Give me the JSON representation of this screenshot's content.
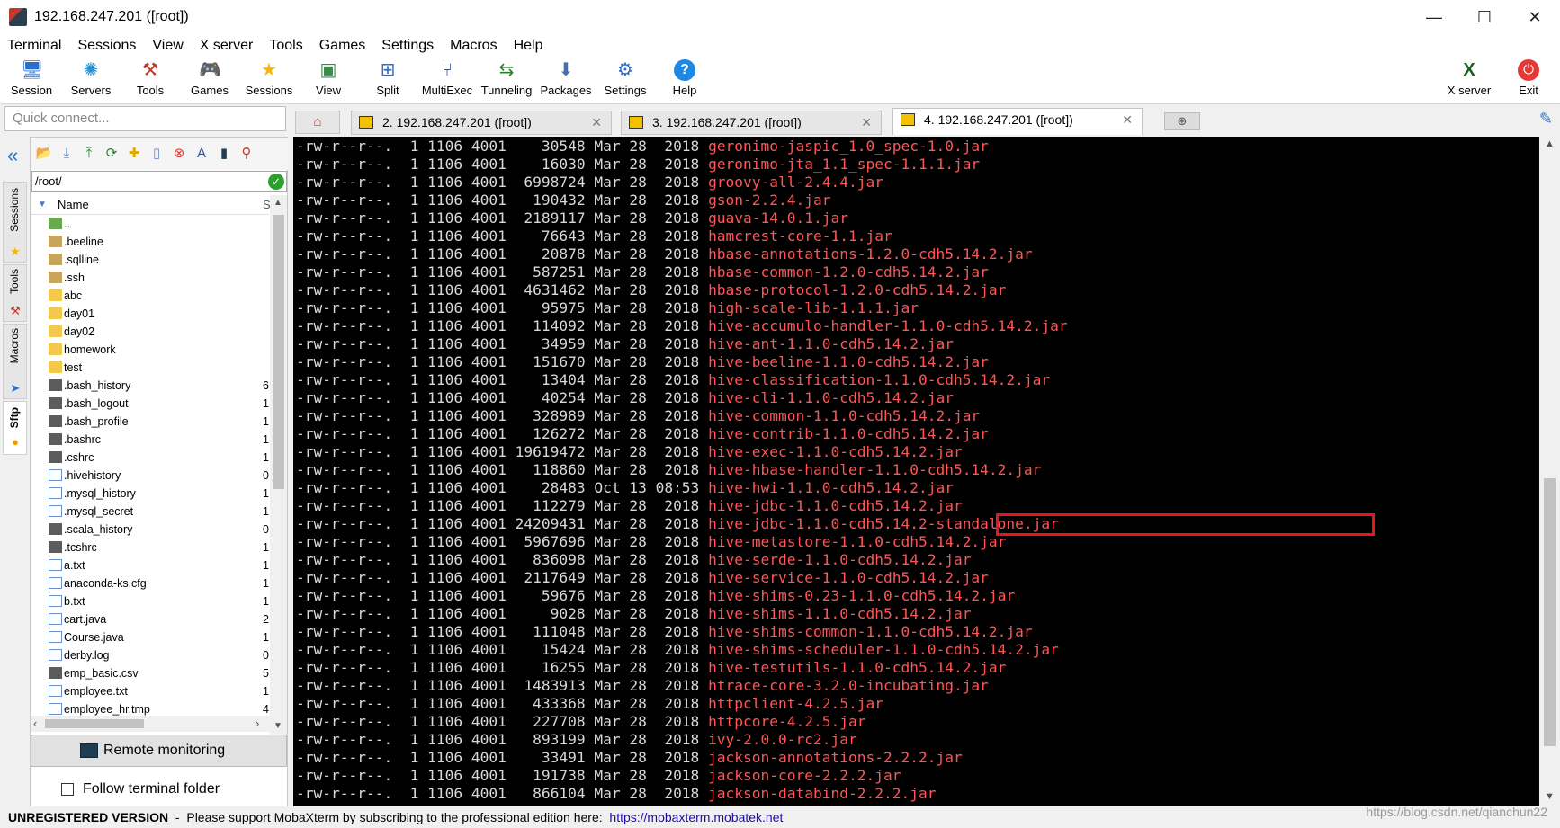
{
  "window": {
    "title": "192.168.247.201 ([root])",
    "minimize": "—",
    "maximize": "☐",
    "close": "✕"
  },
  "menu": [
    "Terminal",
    "Sessions",
    "View",
    "X server",
    "Tools",
    "Games",
    "Settings",
    "Macros",
    "Help"
  ],
  "toolbar": [
    {
      "label": "Session",
      "icon": "session-icon"
    },
    {
      "label": "Servers",
      "icon": "servers-icon"
    },
    {
      "label": "Tools",
      "icon": "tools-icon"
    },
    {
      "label": "Games",
      "icon": "games-icon"
    },
    {
      "label": "Sessions",
      "icon": "star-icon"
    },
    {
      "label": "View",
      "icon": "view-icon"
    },
    {
      "label": "Split",
      "icon": "split-icon"
    },
    {
      "label": "MultiExec",
      "icon": "multiexec-icon"
    },
    {
      "label": "Tunneling",
      "icon": "tunneling-icon"
    },
    {
      "label": "Packages",
      "icon": "packages-icon"
    },
    {
      "label": "Settings",
      "icon": "gear-icon"
    },
    {
      "label": "Help",
      "icon": "help-icon"
    }
  ],
  "toolbar_right": [
    {
      "label": "X server",
      "icon": "x-server-icon"
    },
    {
      "label": "Exit",
      "icon": "power-icon"
    }
  ],
  "quick_connect": {
    "placeholder": "Quick connect..."
  },
  "tabs": [
    {
      "label": "2. 192.168.247.201 ([root])",
      "active": false
    },
    {
      "label": "3. 192.168.247.201 ([root])",
      "active": false
    },
    {
      "label": "4. 192.168.247.201 ([root])",
      "active": true
    }
  ],
  "tab_close": "✕",
  "side_tabs": [
    {
      "label": "Sessions",
      "active": false
    },
    {
      "label": "Tools",
      "active": false
    },
    {
      "label": "Macros",
      "active": false
    },
    {
      "label": "Sftp",
      "active": true
    }
  ],
  "sftp": {
    "path": "/root/",
    "col_name": "Name",
    "col_size": "S",
    "files": [
      {
        "name": "..",
        "type": "up",
        "size": ""
      },
      {
        "name": ".beeline",
        "type": "hidden",
        "size": ""
      },
      {
        "name": ".sqlline",
        "type": "hidden",
        "size": ""
      },
      {
        "name": ".ssh",
        "type": "hidden",
        "size": ""
      },
      {
        "name": "abc",
        "type": "folder",
        "size": ""
      },
      {
        "name": "day01",
        "type": "folder",
        "size": ""
      },
      {
        "name": "day02",
        "type": "folder",
        "size": ""
      },
      {
        "name": "homework",
        "type": "folder",
        "size": ""
      },
      {
        "name": "test",
        "type": "folder",
        "size": ""
      },
      {
        "name": ".bash_history",
        "type": "term",
        "size": "6"
      },
      {
        "name": ".bash_logout",
        "type": "term",
        "size": "1"
      },
      {
        "name": ".bash_profile",
        "type": "term",
        "size": "1"
      },
      {
        "name": ".bashrc",
        "type": "term",
        "size": "1"
      },
      {
        "name": ".cshrc",
        "type": "term",
        "size": "1"
      },
      {
        "name": ".hivehistory",
        "type": "doc",
        "size": "0"
      },
      {
        "name": ".mysql_history",
        "type": "doc",
        "size": "1"
      },
      {
        "name": ".mysql_secret",
        "type": "doc",
        "size": "1"
      },
      {
        "name": ".scala_history",
        "type": "term",
        "size": "0"
      },
      {
        "name": ".tcshrc",
        "type": "term",
        "size": "1"
      },
      {
        "name": "a.txt",
        "type": "doc",
        "size": "1"
      },
      {
        "name": "anaconda-ks.cfg",
        "type": "doc",
        "size": "1"
      },
      {
        "name": "b.txt",
        "type": "doc",
        "size": "1"
      },
      {
        "name": "cart.java",
        "type": "doc",
        "size": "2"
      },
      {
        "name": "Course.java",
        "type": "doc",
        "size": "1"
      },
      {
        "name": "derby.log",
        "type": "doc",
        "size": "0"
      },
      {
        "name": "emp_basic.csv",
        "type": "term",
        "size": "5"
      },
      {
        "name": "employee.txt",
        "type": "doc",
        "size": "1"
      },
      {
        "name": "employee_hr.tmp",
        "type": "doc",
        "size": "4"
      }
    ],
    "remote_monitoring": "Remote monitoring",
    "follow_terminal": "Follow terminal folder"
  },
  "terminal": {
    "lines": [
      {
        "perm": "-rw-r--r--.",
        "links": "1",
        "user": "1106",
        "group": "4001",
        "size": "30548",
        "date": "Mar 28  2018",
        "name": "geronimo-jaspic_1.0_spec-1.0.jar"
      },
      {
        "perm": "-rw-r--r--.",
        "links": "1",
        "user": "1106",
        "group": "4001",
        "size": "16030",
        "date": "Mar 28  2018",
        "name": "geronimo-jta_1.1_spec-1.1.1.jar"
      },
      {
        "perm": "-rw-r--r--.",
        "links": "1",
        "user": "1106",
        "group": "4001",
        "size": "6998724",
        "date": "Mar 28  2018",
        "name": "groovy-all-2.4.4.jar"
      },
      {
        "perm": "-rw-r--r--.",
        "links": "1",
        "user": "1106",
        "group": "4001",
        "size": "190432",
        "date": "Mar 28  2018",
        "name": "gson-2.2.4.jar"
      },
      {
        "perm": "-rw-r--r--.",
        "links": "1",
        "user": "1106",
        "group": "4001",
        "size": "2189117",
        "date": "Mar 28  2018",
        "name": "guava-14.0.1.jar"
      },
      {
        "perm": "-rw-r--r--.",
        "links": "1",
        "user": "1106",
        "group": "4001",
        "size": "76643",
        "date": "Mar 28  2018",
        "name": "hamcrest-core-1.1.jar"
      },
      {
        "perm": "-rw-r--r--.",
        "links": "1",
        "user": "1106",
        "group": "4001",
        "size": "20878",
        "date": "Mar 28  2018",
        "name": "hbase-annotations-1.2.0-cdh5.14.2.jar"
      },
      {
        "perm": "-rw-r--r--.",
        "links": "1",
        "user": "1106",
        "group": "4001",
        "size": "587251",
        "date": "Mar 28  2018",
        "name": "hbase-common-1.2.0-cdh5.14.2.jar"
      },
      {
        "perm": "-rw-r--r--.",
        "links": "1",
        "user": "1106",
        "group": "4001",
        "size": "4631462",
        "date": "Mar 28  2018",
        "name": "hbase-protocol-1.2.0-cdh5.14.2.jar"
      },
      {
        "perm": "-rw-r--r--.",
        "links": "1",
        "user": "1106",
        "group": "4001",
        "size": "95975",
        "date": "Mar 28  2018",
        "name": "high-scale-lib-1.1.1.jar"
      },
      {
        "perm": "-rw-r--r--.",
        "links": "1",
        "user": "1106",
        "group": "4001",
        "size": "114092",
        "date": "Mar 28  2018",
        "name": "hive-accumulo-handler-1.1.0-cdh5.14.2.jar"
      },
      {
        "perm": "-rw-r--r--.",
        "links": "1",
        "user": "1106",
        "group": "4001",
        "size": "34959",
        "date": "Mar 28  2018",
        "name": "hive-ant-1.1.0-cdh5.14.2.jar"
      },
      {
        "perm": "-rw-r--r--.",
        "links": "1",
        "user": "1106",
        "group": "4001",
        "size": "151670",
        "date": "Mar 28  2018",
        "name": "hive-beeline-1.1.0-cdh5.14.2.jar"
      },
      {
        "perm": "-rw-r--r--.",
        "links": "1",
        "user": "1106",
        "group": "4001",
        "size": "13404",
        "date": "Mar 28  2018",
        "name": "hive-classification-1.1.0-cdh5.14.2.jar"
      },
      {
        "perm": "-rw-r--r--.",
        "links": "1",
        "user": "1106",
        "group": "4001",
        "size": "40254",
        "date": "Mar 28  2018",
        "name": "hive-cli-1.1.0-cdh5.14.2.jar"
      },
      {
        "perm": "-rw-r--r--.",
        "links": "1",
        "user": "1106",
        "group": "4001",
        "size": "328989",
        "date": "Mar 28  2018",
        "name": "hive-common-1.1.0-cdh5.14.2.jar"
      },
      {
        "perm": "-rw-r--r--.",
        "links": "1",
        "user": "1106",
        "group": "4001",
        "size": "126272",
        "date": "Mar 28  2018",
        "name": "hive-contrib-1.1.0-cdh5.14.2.jar"
      },
      {
        "perm": "-rw-r--r--.",
        "links": "1",
        "user": "1106",
        "group": "4001",
        "size": "19619472",
        "date": "Mar 28  2018",
        "name": "hive-exec-1.1.0-cdh5.14.2.jar"
      },
      {
        "perm": "-rw-r--r--.",
        "links": "1",
        "user": "1106",
        "group": "4001",
        "size": "118860",
        "date": "Mar 28  2018",
        "name": "hive-hbase-handler-1.1.0-cdh5.14.2.jar"
      },
      {
        "perm": "-rw-r--r--.",
        "links": "1",
        "user": "1106",
        "group": "4001",
        "size": "28483",
        "date": "Oct 13 08:53",
        "name": "hive-hwi-1.1.0-cdh5.14.2.jar"
      },
      {
        "perm": "-rw-r--r--.",
        "links": "1",
        "user": "1106",
        "group": "4001",
        "size": "112279",
        "date": "Mar 28  2018",
        "name": "hive-jdbc-1.1.0-cdh5.14.2.jar"
      },
      {
        "perm": "-rw-r--r--.",
        "links": "1",
        "user": "1106",
        "group": "4001",
        "size": "24209431",
        "date": "Mar 28  2018",
        "name": "hive-jdbc-1.1.0-cdh5.14.2-standalone.jar"
      },
      {
        "perm": "-rw-r--r--.",
        "links": "1",
        "user": "1106",
        "group": "4001",
        "size": "5967696",
        "date": "Mar 28  2018",
        "name": "hive-metastore-1.1.0-cdh5.14.2.jar"
      },
      {
        "perm": "-rw-r--r--.",
        "links": "1",
        "user": "1106",
        "group": "4001",
        "size": "836098",
        "date": "Mar 28  2018",
        "name": "hive-serde-1.1.0-cdh5.14.2.jar"
      },
      {
        "perm": "-rw-r--r--.",
        "links": "1",
        "user": "1106",
        "group": "4001",
        "size": "2117649",
        "date": "Mar 28  2018",
        "name": "hive-service-1.1.0-cdh5.14.2.jar"
      },
      {
        "perm": "-rw-r--r--.",
        "links": "1",
        "user": "1106",
        "group": "4001",
        "size": "59676",
        "date": "Mar 28  2018",
        "name": "hive-shims-0.23-1.1.0-cdh5.14.2.jar"
      },
      {
        "perm": "-rw-r--r--.",
        "links": "1",
        "user": "1106",
        "group": "4001",
        "size": "9028",
        "date": "Mar 28  2018",
        "name": "hive-shims-1.1.0-cdh5.14.2.jar"
      },
      {
        "perm": "-rw-r--r--.",
        "links": "1",
        "user": "1106",
        "group": "4001",
        "size": "111048",
        "date": "Mar 28  2018",
        "name": "hive-shims-common-1.1.0-cdh5.14.2.jar"
      },
      {
        "perm": "-rw-r--r--.",
        "links": "1",
        "user": "1106",
        "group": "4001",
        "size": "15424",
        "date": "Mar 28  2018",
        "name": "hive-shims-scheduler-1.1.0-cdh5.14.2.jar"
      },
      {
        "perm": "-rw-r--r--.",
        "links": "1",
        "user": "1106",
        "group": "4001",
        "size": "16255",
        "date": "Mar 28  2018",
        "name": "hive-testutils-1.1.0-cdh5.14.2.jar"
      },
      {
        "perm": "-rw-r--r--.",
        "links": "1",
        "user": "1106",
        "group": "4001",
        "size": "1483913",
        "date": "Mar 28  2018",
        "name": "htrace-core-3.2.0-incubating.jar"
      },
      {
        "perm": "-rw-r--r--.",
        "links": "1",
        "user": "1106",
        "group": "4001",
        "size": "433368",
        "date": "Mar 28  2018",
        "name": "httpclient-4.2.5.jar"
      },
      {
        "perm": "-rw-r--r--.",
        "links": "1",
        "user": "1106",
        "group": "4001",
        "size": "227708",
        "date": "Mar 28  2018",
        "name": "httpcore-4.2.5.jar"
      },
      {
        "perm": "-rw-r--r--.",
        "links": "1",
        "user": "1106",
        "group": "4001",
        "size": "893199",
        "date": "Mar 28  2018",
        "name": "ivy-2.0.0-rc2.jar"
      },
      {
        "perm": "-rw-r--r--.",
        "links": "1",
        "user": "1106",
        "group": "4001",
        "size": "33491",
        "date": "Mar 28  2018",
        "name": "jackson-annotations-2.2.2.jar"
      },
      {
        "perm": "-rw-r--r--.",
        "links": "1",
        "user": "1106",
        "group": "4001",
        "size": "191738",
        "date": "Mar 28  2018",
        "name": "jackson-core-2.2.2.jar"
      },
      {
        "perm": "-rw-r--r--.",
        "links": "1",
        "user": "1106",
        "group": "4001",
        "size": "866104",
        "date": "Mar 28  2018",
        "name": "jackson-databind-2.2.2.jar"
      }
    ],
    "highlighted_file": "hive-jdbc-1.1.0-cdh5.14.2-standalone.jar",
    "highlight_color": "#e8161b",
    "file_name_color": "#ff5555"
  },
  "status": {
    "unregistered": "UNREGISTERED VERSION",
    "message": "  -  Please support MobaXterm by subscribing to the professional edition here:  ",
    "link": "https://mobaxterm.mobatek.net"
  },
  "watermark": "https://blog.csdn.net/qianchun22"
}
